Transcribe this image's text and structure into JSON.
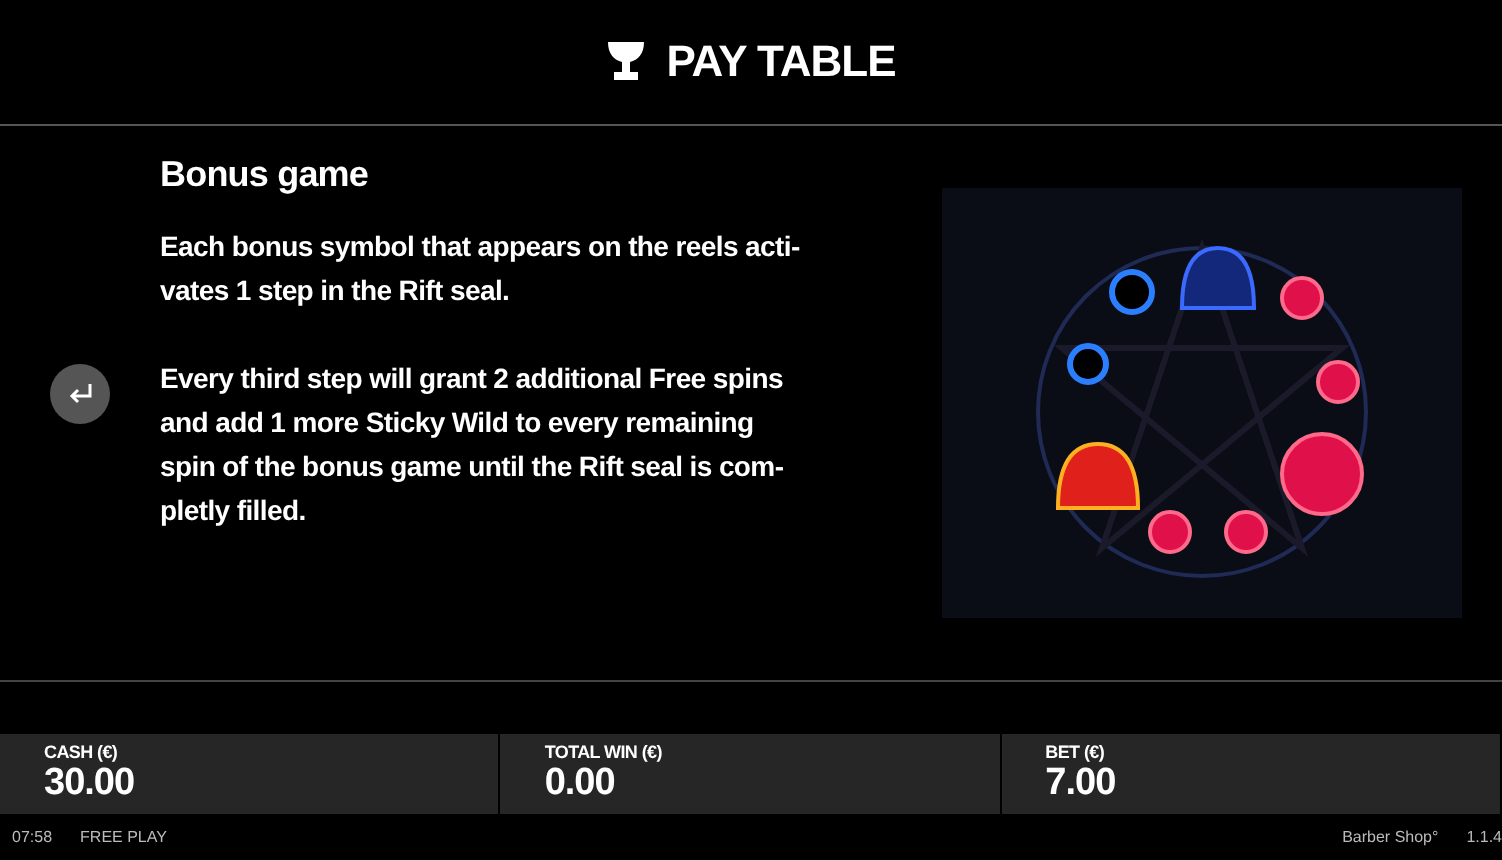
{
  "header": {
    "title": "PAY TABLE"
  },
  "section": {
    "heading": "Bonus game",
    "paragraphs": [
      "Each bonus symbol that appears on the reels acti-\nvates 1 step in the Rift seal.",
      "Every third step will grant 2 additional Free spins\nand add 1 more Sticky Wild to every remaining\nspin of the bonus game until the Rift seal is com-\npletly filled."
    ]
  },
  "balances": [
    {
      "label": "CASH (€)",
      "value": "30.00"
    },
    {
      "label": "TOTAL WIN (€)",
      "value": "0.00"
    },
    {
      "label": "BET (€)",
      "value": "7.00"
    }
  ],
  "status_bar": {
    "time": "07:58",
    "mode": "FREE PLAY",
    "game": "Barber Shop°",
    "version": "1.1.4"
  }
}
